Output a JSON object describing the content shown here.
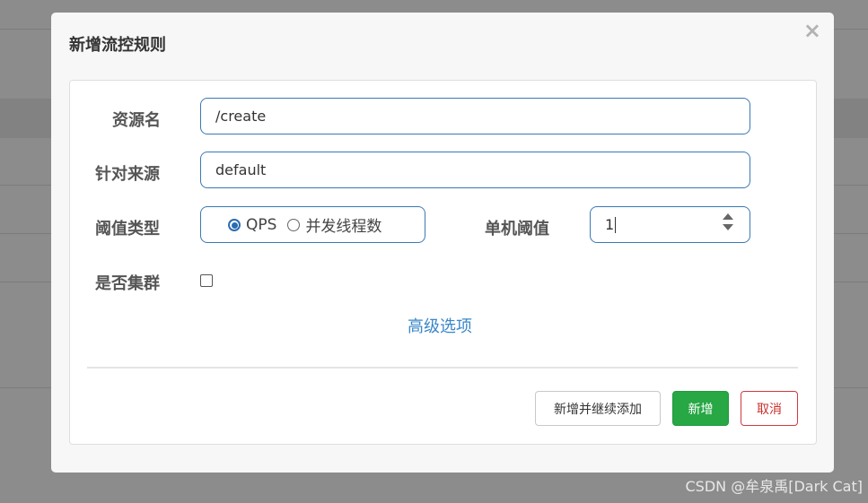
{
  "dialog": {
    "title": "新增流控规则",
    "close_symbol": "×"
  },
  "form": {
    "resource_label": "资源名",
    "resource_value": "/create",
    "source_label": "针对来源",
    "source_value": "default",
    "threshold_type_label": "阈值类型",
    "threshold_type_options": [
      "QPS",
      "并发线程数"
    ],
    "threshold_type_selected": "QPS",
    "single_threshold_label": "单机阈值",
    "single_threshold_value": "1",
    "cluster_label": "是否集群",
    "cluster_checked": false,
    "advanced_link": "高级选项"
  },
  "footer": {
    "add_continue_label": "新增并继续添加",
    "add_label": "新增",
    "cancel_label": "取消"
  },
  "watermark": "CSDN @牟泉禹[Dark Cat]",
  "colors": {
    "primary_border": "#3b78b4",
    "success": "#28a745",
    "danger": "#c9302c",
    "link": "#3a87c8"
  }
}
